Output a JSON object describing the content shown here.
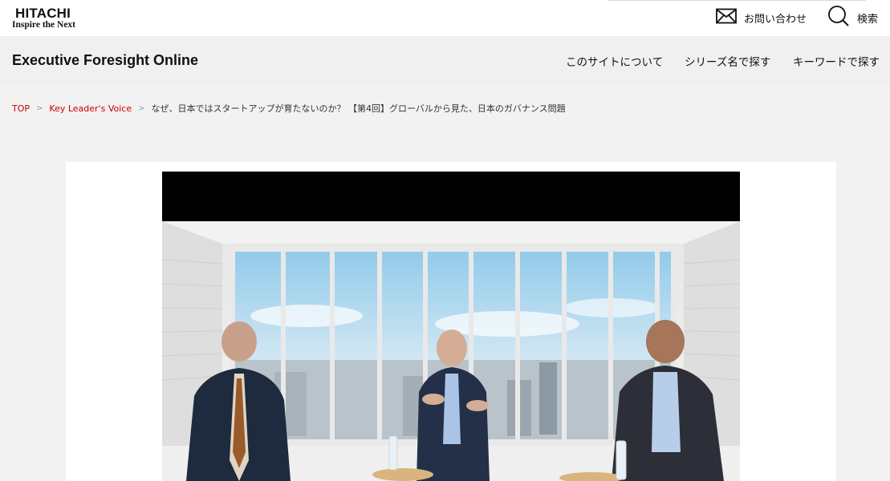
{
  "header": {
    "logo_main": "HITACHI",
    "logo_tagline": "Inspire the Next",
    "contact_label": "お問い合わせ",
    "search_label": "検索"
  },
  "site": {
    "title": "Executive Foresight Online",
    "nav": [
      "このサイトについて",
      "シリーズ名で探す",
      "キーワードで探す"
    ]
  },
  "breadcrumb": {
    "items": [
      "TOP",
      "Key Leader's Voice"
    ],
    "separator": ">",
    "current": "なぜ、日本ではスタートアップが育たないのか？ 【第4回】グローバルから見た、日本のガバナンス問題"
  },
  "video": {
    "description_icon": "video-frame"
  },
  "colors": {
    "accent": "#cc0000",
    "page_bg": "#f2f2f2",
    "header_bg": "#f0f0f0"
  }
}
